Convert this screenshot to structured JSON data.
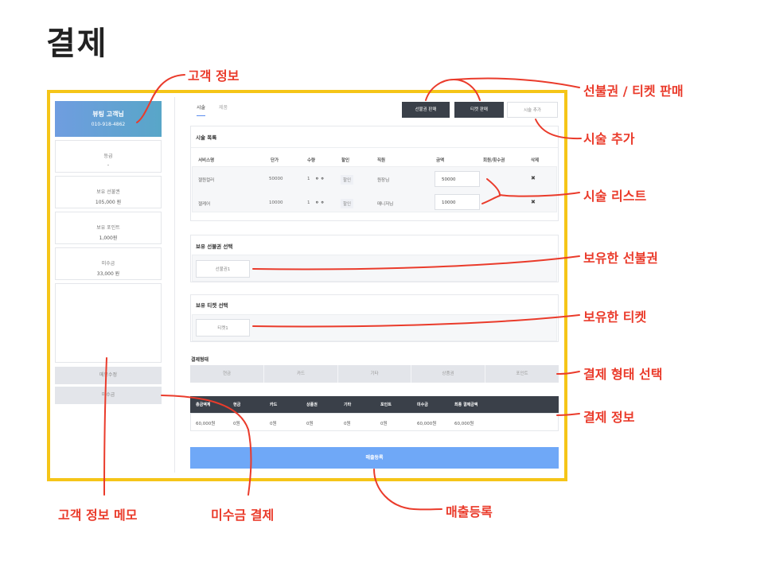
{
  "page_title": "결제",
  "sidebar": {
    "customer_name": "뷰팅 고객님",
    "customer_phone": "010-918-4862",
    "boxes": [
      {
        "label": "등급",
        "value": "-"
      },
      {
        "label": "보유 선불권",
        "value": "105,000 원"
      },
      {
        "label": "보유 포인트",
        "value": "1,000원"
      },
      {
        "label": "미수금",
        "value": "33,000 원"
      }
    ],
    "memo_button": "메모수정",
    "unpaid_button": "미수금"
  },
  "tabs": [
    "시술",
    "제품"
  ],
  "toolbar": {
    "prepaid_sale": "선불권 판매",
    "ticket_sale": "티켓 판매",
    "add_service": "시술 추가"
  },
  "service_list": {
    "title": "시술 목록",
    "headers": [
      "서비스명",
      "단가",
      "수량",
      "할인",
      "직원",
      "금액",
      "회원/횟수권",
      "삭제"
    ],
    "rows": [
      {
        "name": "젤원컬러",
        "price": "50000",
        "qty": "1",
        "discount": "할인",
        "staff": "원장님",
        "amount": "50000",
        "delete": "✖"
      },
      {
        "name": "젤케어",
        "price": "10000",
        "qty": "1",
        "discount": "할인",
        "staff": "매니저님",
        "amount": "10000",
        "delete": "✖"
      }
    ]
  },
  "prepaid_select": {
    "title": "보유 선불권 선택",
    "item": "선불권1"
  },
  "ticket_select": {
    "title": "보유 티켓 선택",
    "item": "티켓1"
  },
  "payment_type": {
    "title": "결제형태",
    "options": [
      "현금",
      "카드",
      "기타",
      "상품권",
      "포인트"
    ]
  },
  "payment_summary": {
    "headers": [
      "총금액계",
      "현금",
      "카드",
      "상품권",
      "기타",
      "포인트",
      "미수금",
      "최종 결제금액"
    ],
    "values": [
      "60,000원",
      "0원",
      "0원",
      "0원",
      "0원",
      "0원",
      "60,000원",
      "60,000원"
    ]
  },
  "submit_button": "매출등록",
  "annotations": {
    "customer_info": "고객 정보",
    "prepaid_ticket_sale": "선불권 / 티켓 판매",
    "add_service": "시술 추가",
    "service_list": "시술 리스트",
    "owned_prepaid": "보유한 선불권",
    "owned_ticket": "보유한 티켓",
    "payment_type_select": "결제 형태 선택",
    "payment_info": "결제 정보",
    "customer_memo": "고객 정보 메모",
    "unpaid_payment": "미수금 결제",
    "sales_register": "매출등록"
  },
  "colors": {
    "frame": "#f5c518",
    "annotation": "#ea3b2b",
    "dark_button": "#3a4049",
    "submit": "#6fa8f7"
  }
}
